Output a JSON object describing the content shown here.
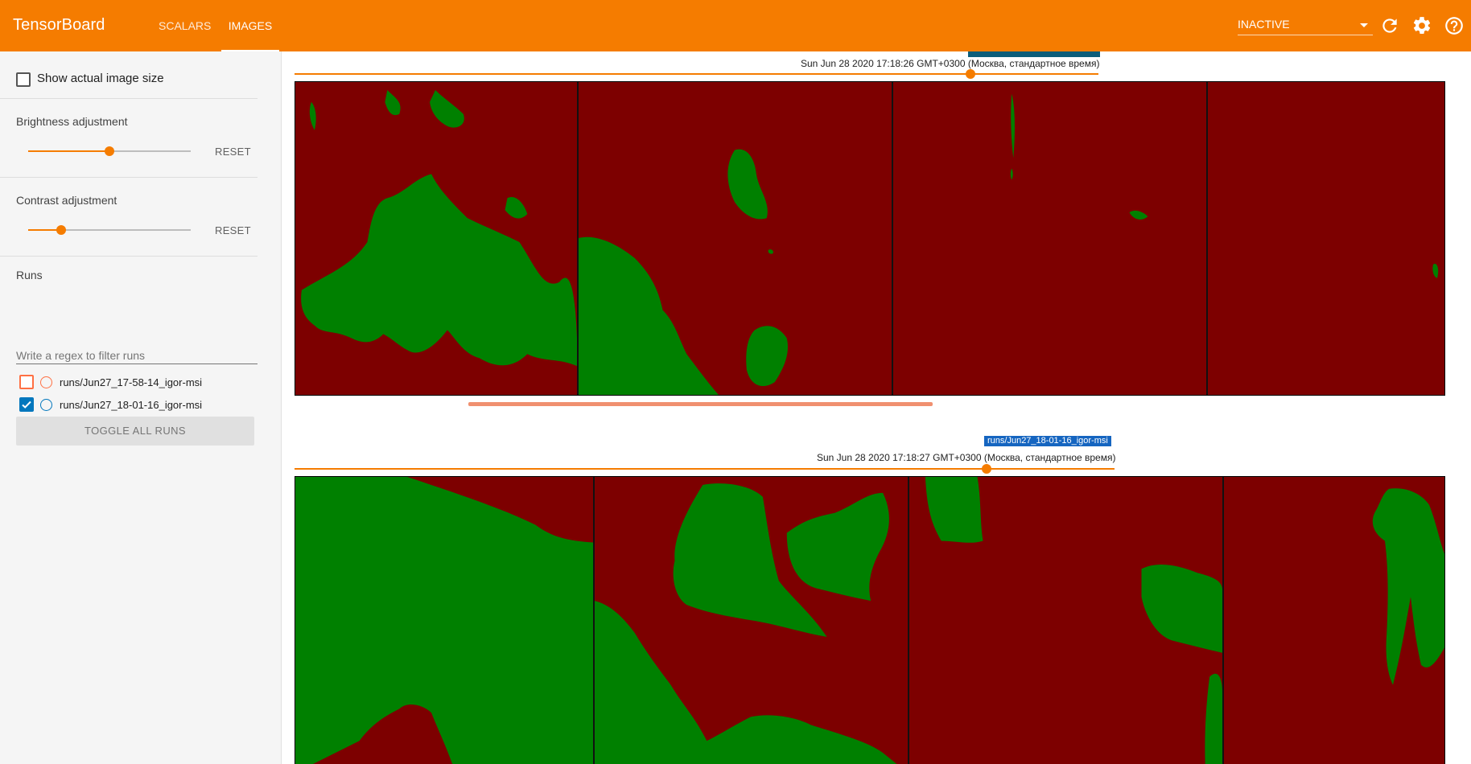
{
  "app": {
    "title": "TensorBoard",
    "tabs": [
      {
        "label": "SCALARS"
      },
      {
        "label": "IMAGES",
        "active": true
      }
    ],
    "run_select_value": "INACTIVE",
    "icons": [
      "refresh-icon",
      "settings-icon",
      "help-icon"
    ],
    "accent_color": "#f57c00"
  },
  "sidebar": {
    "show_actual_size_label": "Show actual image size",
    "show_actual_size_checked": false,
    "brightness": {
      "label": "Brightness adjustment",
      "value_fraction": 0.5,
      "reset_label": "RESET"
    },
    "contrast": {
      "label": "Contrast adjustment",
      "value_fraction": 0.2,
      "reset_label": "RESET"
    },
    "runs": {
      "heading": "Runs",
      "filter_placeholder": "Write a regex to filter runs",
      "items": [
        {
          "name": "runs/Jun27_17-58-14_igor-msi",
          "checked": false,
          "color": "#ff7043"
        },
        {
          "name": "runs/Jun27_18-01-16_igor-msi",
          "checked": true,
          "color": "#0277bd"
        }
      ],
      "toggle_label": "TOGGLE ALL RUNS"
    }
  },
  "main": {
    "cards": [
      {
        "timestamp": "Sun Jun 28 2020 17:18:26 GMT+0300 (Москва, стандартное время)",
        "step_fraction": 0.84,
        "run_label": ""
      },
      {
        "timestamp": "Sun Jun 28 2020 17:18:27 GMT+0300 (Москва, стандартное время)",
        "step_fraction": 0.84,
        "run_label": "runs/Jun27_18-01-16_igor-msi"
      }
    ],
    "mask_colors": {
      "background": "#7d0000",
      "foreground": "#008000"
    }
  }
}
